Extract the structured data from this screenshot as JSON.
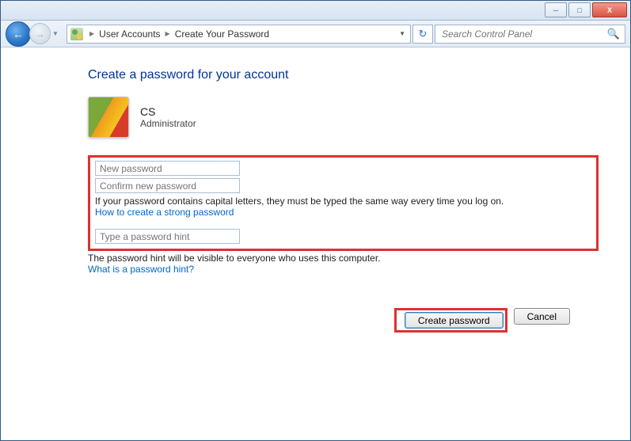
{
  "window": {
    "minimize": "─",
    "maximize": "□",
    "close": "X"
  },
  "nav": {
    "back": "←",
    "forward": "→",
    "refresh": "↻"
  },
  "breadcrumb": {
    "level1": "User Accounts",
    "level2": "Create Your Password"
  },
  "search": {
    "placeholder": "Search Control Panel"
  },
  "page": {
    "heading": "Create a password for your account",
    "user_name": "CS",
    "user_role": "Administrator",
    "new_password_ph": "New password",
    "confirm_password_ph": "Confirm new password",
    "caps_note": "If your password contains capital letters, they must be typed the same way every time you log on.",
    "strong_link": "How to create a strong password",
    "hint_ph": "Type a password hint",
    "hint_note": "The password hint will be visible to everyone who uses this computer.",
    "hint_link": "What is a password hint?",
    "create_btn": "Create password",
    "cancel_btn": "Cancel"
  }
}
